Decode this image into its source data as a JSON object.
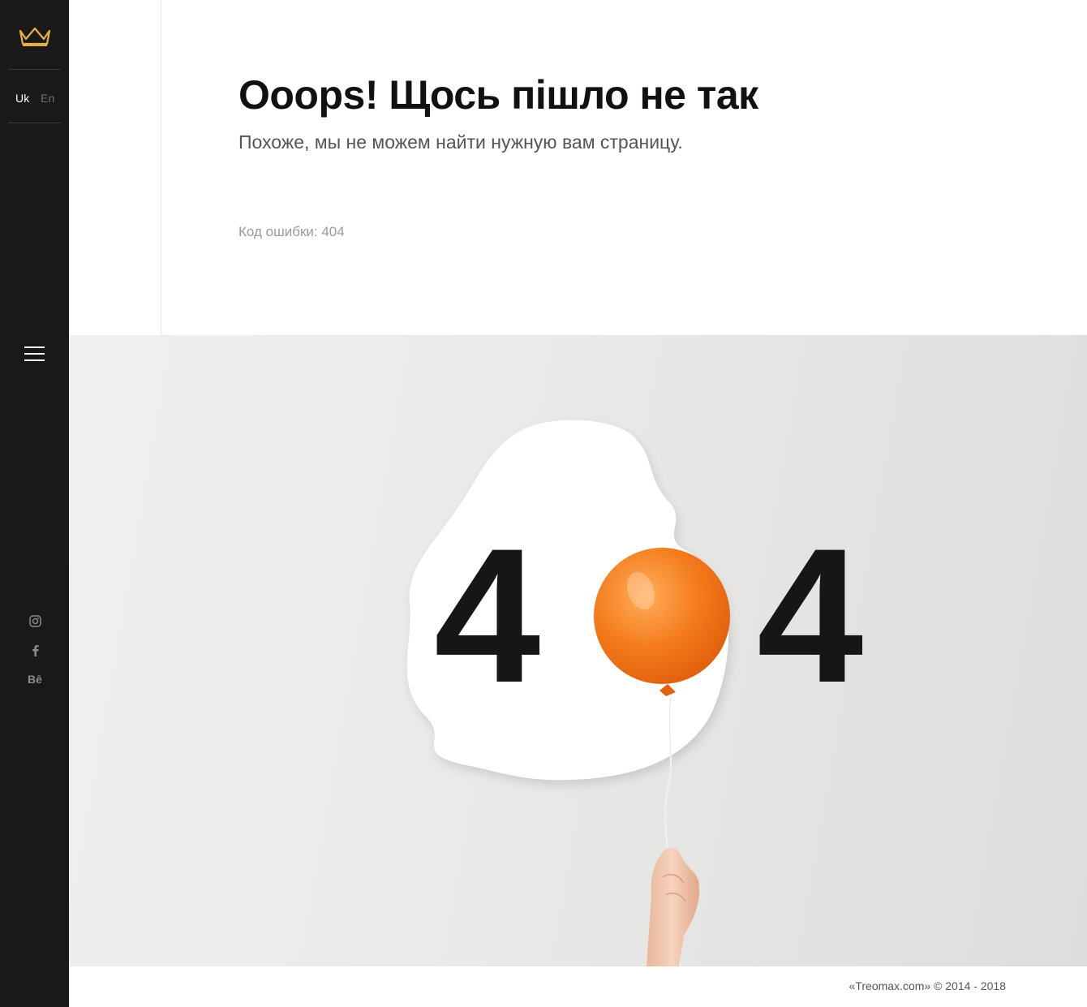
{
  "sidebar": {
    "logo_icon": "crown-icon",
    "logo_color": "#e7b043",
    "languages": [
      {
        "label": "Uk",
        "active": true
      },
      {
        "label": "En",
        "active": false
      }
    ],
    "menu_icon": "hamburger-menu-icon",
    "social": [
      {
        "name": "instagram-icon"
      },
      {
        "name": "facebook-icon"
      },
      {
        "name": "behance-icon",
        "glyph": "Bē"
      }
    ]
  },
  "main": {
    "title": "Ooops! Щось пішло не так",
    "subtitle": "Похоже, мы не можем найти нужную вам страницу.",
    "error_code": "Код ошибки: 404"
  },
  "hero": {
    "digit_left": "4",
    "digit_right": "4",
    "balloon_color": "#f47c1c"
  },
  "footer": {
    "copyright": "«Treomax.com» © 2014 - 2018"
  }
}
